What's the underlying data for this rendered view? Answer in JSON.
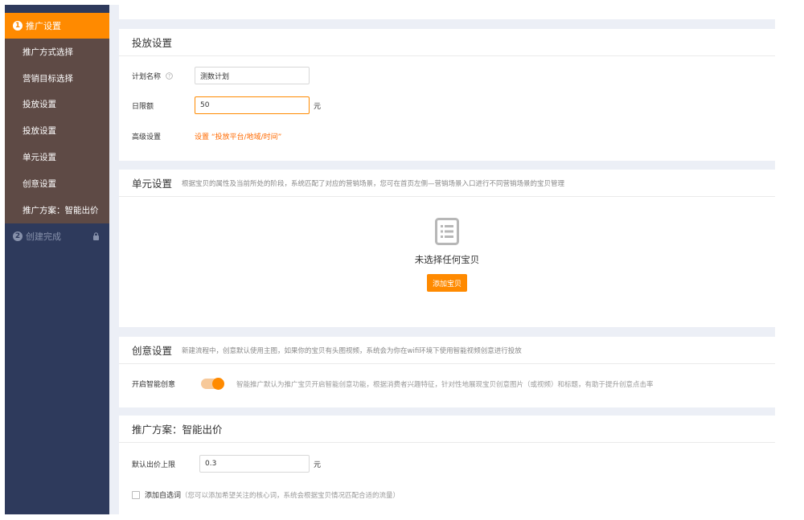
{
  "sidebar": {
    "step1": {
      "num": "1",
      "label": "推广设置"
    },
    "sub_items": [
      "推广方式选择",
      "营销目标选择",
      "投放设置",
      "投放设置",
      "单元设置",
      "创意设置",
      "推广方案：智能出价"
    ],
    "step2": {
      "num": "2",
      "label": "创建完成"
    }
  },
  "delivery": {
    "title": "投放设置",
    "plan_name_label": "计划名称",
    "plan_name_value": "测数计划",
    "daily_limit_label": "日限额",
    "daily_limit_value": "50",
    "daily_limit_unit": "元",
    "advanced_label": "高级设置",
    "advanced_link": "设置 “投放平台/地域/时间”"
  },
  "unit": {
    "title": "单元设置",
    "desc": "根据宝贝的属性及当前所处的阶段，系统匹配了对应的营销场景，您可在首页左侧—营销场景入口进行不同营销场景的宝贝管理",
    "empty_text": "未选择任何宝贝",
    "add_button": "添加宝贝"
  },
  "creative": {
    "title": "创意设置",
    "desc": "新建流程中，创意默认使用主图，如果你的宝贝有头图视频，系统会为你在wifi环境下使用智能视频创意进行投放",
    "smart_label": "开启智能创意",
    "smart_on": true,
    "smart_desc": "智能推广默认为推广宝贝开启智能创意功能，根据消费者兴趣特征，针对性地展现宝贝创意图片（或视频）和标题，有助于提升创意点击率"
  },
  "plan": {
    "title": "推广方案：智能出价",
    "bid_limit_label": "默认出价上限",
    "bid_limit_value": "0.3",
    "bid_limit_unit": "元",
    "add_word_label": "添加自选词",
    "add_word_hint": "（您可以添加希望关注的核心词，系统会根据宝贝情况匹配合适的流量）"
  },
  "colors": {
    "accent": "#ff8a00",
    "sidebar_bg": "#2e3a5c",
    "sub_bg": "#5e4a45"
  }
}
